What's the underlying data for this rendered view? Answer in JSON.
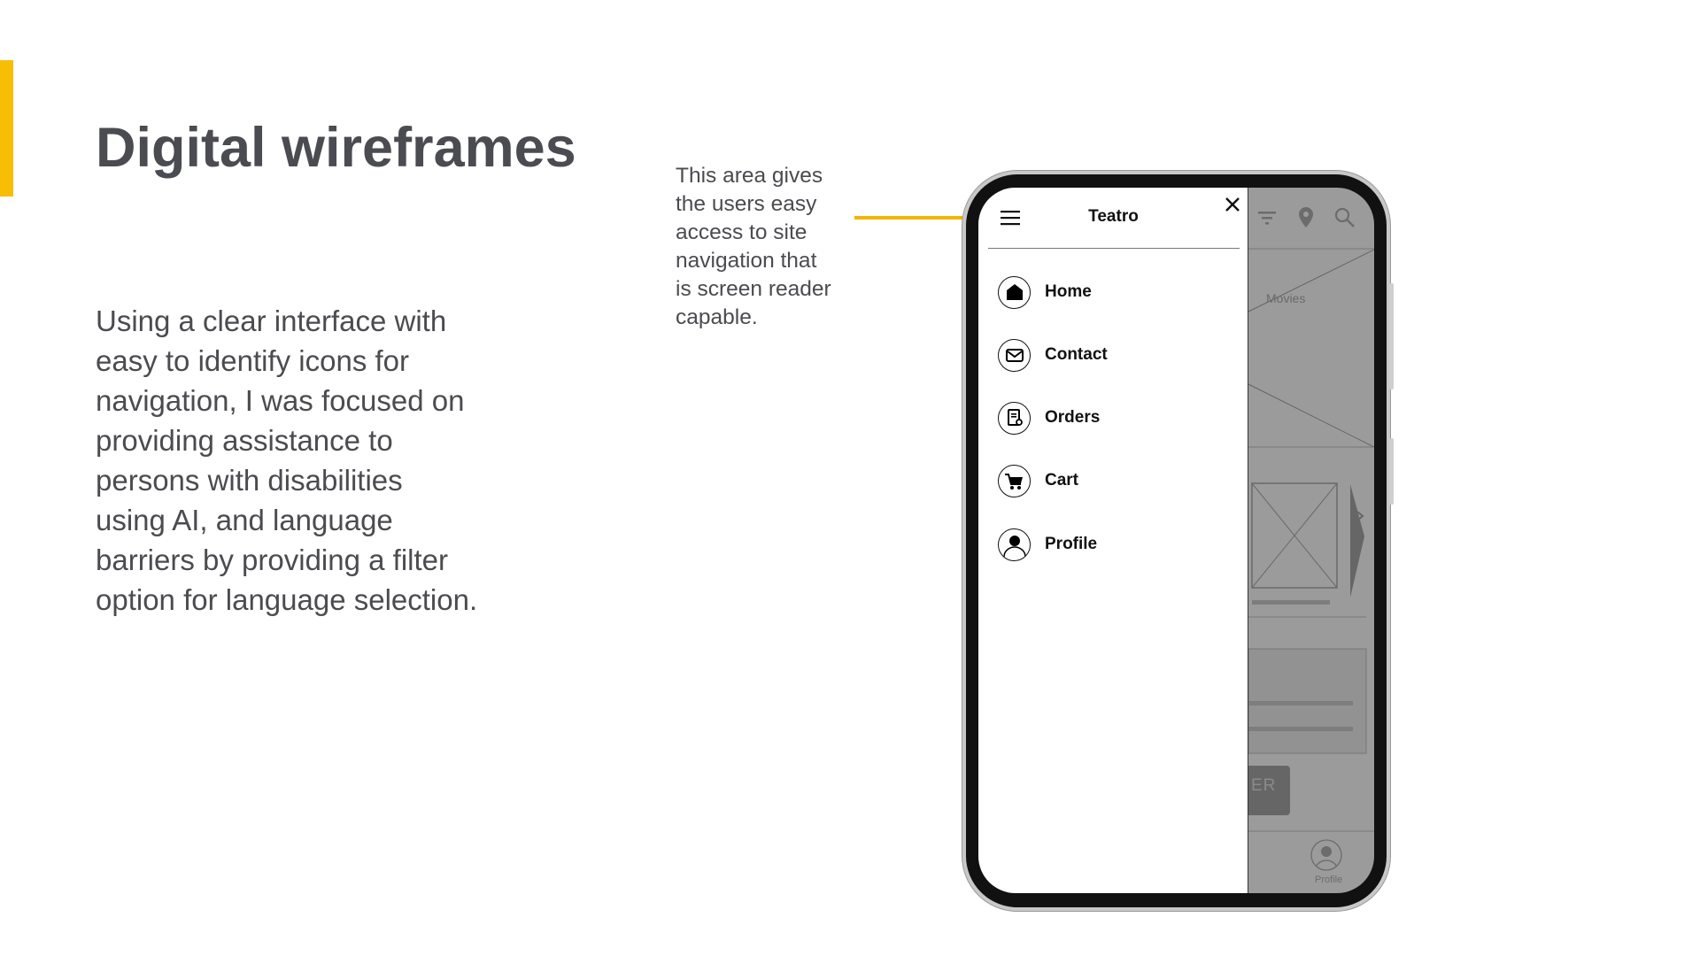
{
  "slide": {
    "title": "Digital wireframes",
    "accent_color": "#f8bd05",
    "body_lines": [
      "Using a clear interface with",
      "easy to identify icons for",
      "navigation, I was focused on",
      "providing assistance to",
      "persons with disabilities",
      "using AI, and language",
      "barriers by providing a filter",
      "option for language selection."
    ],
    "annotation_lines": [
      "This area gives",
      "the users easy",
      "access to site",
      "navigation that",
      "is screen reader",
      "capable."
    ]
  },
  "phone": {
    "drawer": {
      "title": "Teatro",
      "menu_icon": "hamburger-icon",
      "close_icon": "close-icon",
      "items": [
        {
          "label": "Home",
          "icon": "home-icon"
        },
        {
          "label": "Contact",
          "icon": "mail-icon"
        },
        {
          "label": "Orders",
          "icon": "orders-icon"
        },
        {
          "label": "Cart",
          "icon": "cart-icon"
        },
        {
          "label": "Profile",
          "icon": "profile-icon"
        }
      ]
    },
    "background": {
      "header_icons": [
        "filter-icon",
        "location-pin-icon",
        "search-icon"
      ],
      "section_label": "Movies",
      "button_label_fragment": "ER",
      "bottom_nav_label": "Profile"
    }
  }
}
